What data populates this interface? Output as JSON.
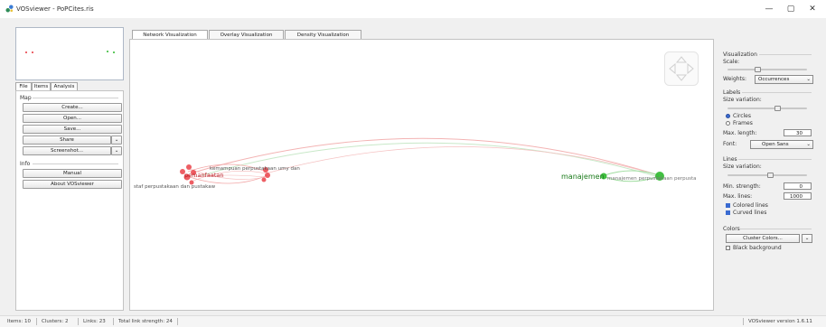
{
  "window": {
    "title": "VOSviewer - PoPCites.ris"
  },
  "left_tabs": [
    "File",
    "Items",
    "Analysis"
  ],
  "map_section": {
    "title": "Map",
    "buttons": {
      "create": "Create...",
      "open": "Open...",
      "save": "Save...",
      "share": "Share",
      "screenshot": "Screenshot..."
    }
  },
  "info_section": {
    "title": "Info",
    "buttons": {
      "manual": "Manual",
      "about": "About VOSviewer"
    }
  },
  "main_tabs": [
    "Network Visualization",
    "Overlay Visualization",
    "Density Visualization"
  ],
  "network": {
    "labels": {
      "pemanfaatan": "pemanfaatan",
      "kemampuan": "kemampuan perpustakaan umy dan",
      "staf": "staf perpustakaan dan pustakaw",
      "manajemen": "manajemen",
      "manajemen_perpus": "manajemen perpustakaan perpusta"
    },
    "colors": {
      "cluster1": "#e8363d",
      "cluster2": "#2db82d"
    }
  },
  "panel": {
    "visualization_title": "Visualization",
    "scale_label": "Scale:",
    "weights_label": "Weights:",
    "weights_value": "Occurrences",
    "labels_title": "Labels",
    "size_variation_label": "Size variation:",
    "circles_label": "Circles",
    "frames_label": "Frames",
    "max_length_label": "Max. length:",
    "max_length_value": "30",
    "font_label": "Font:",
    "font_value": "Open Sans",
    "lines_title": "Lines",
    "lines_size_variation_label": "Size variation:",
    "min_strength_label": "Min. strength:",
    "min_strength_value": "0",
    "max_lines_label": "Max. lines:",
    "max_lines_value": "1000",
    "colored_lines_label": "Colored lines",
    "curved_lines_label": "Curved lines",
    "colors_title": "Colors",
    "cluster_colors_label": "Cluster Colors...",
    "black_background_label": "Black background"
  },
  "status_bar": {
    "items": "Items:  10",
    "clusters": "Clusters:  2",
    "links": "Links:  23",
    "total_link_strength": "Total link strength:  24",
    "version": "VOSviewer version 1.6.11"
  }
}
